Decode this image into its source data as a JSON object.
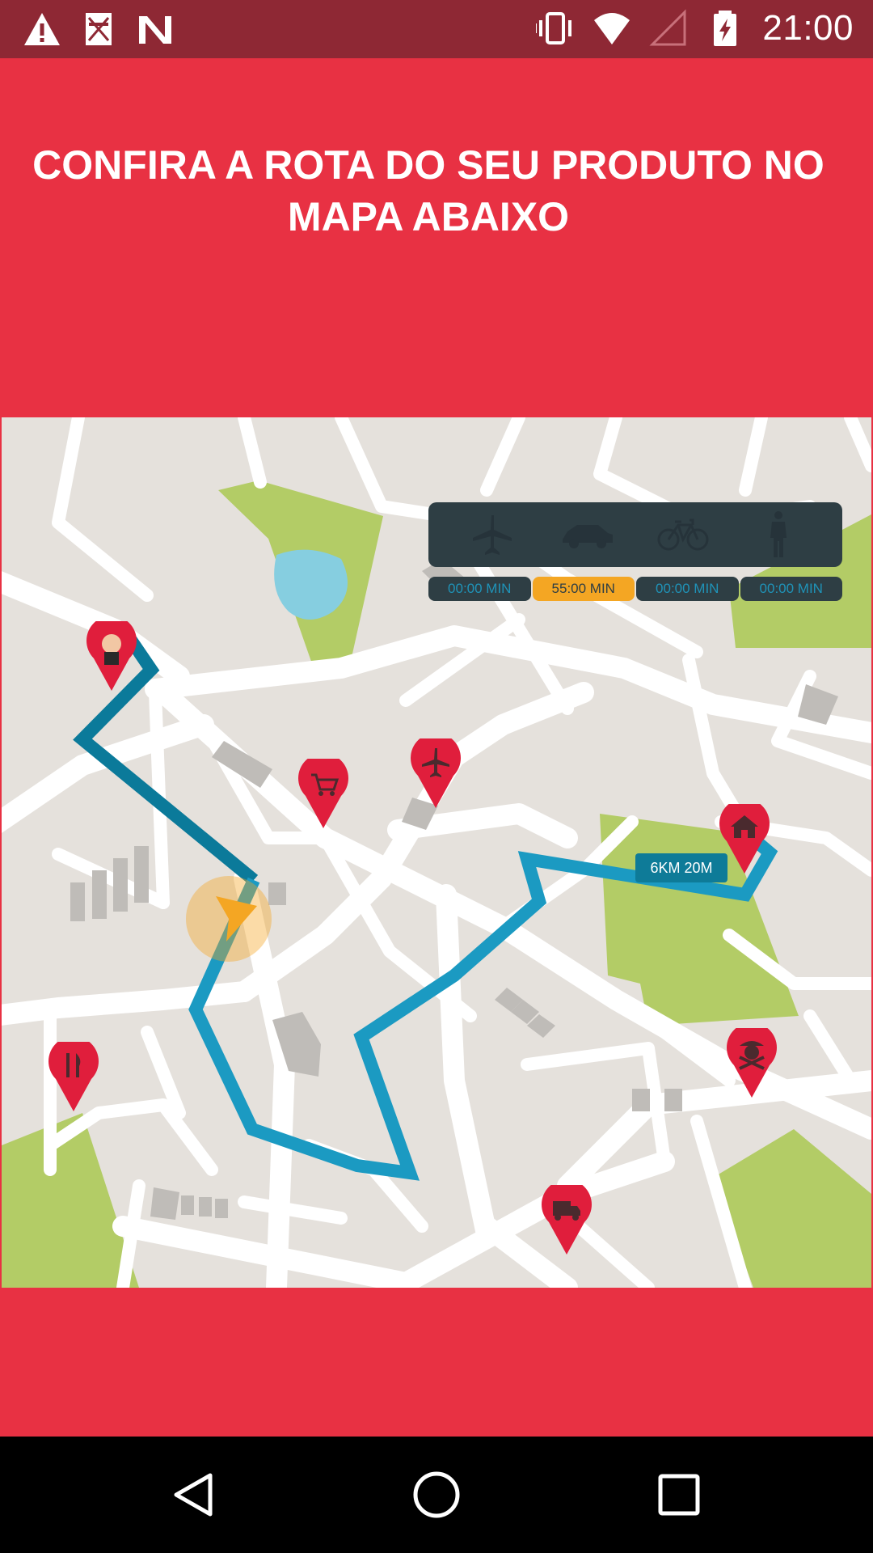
{
  "status_bar": {
    "time": "21:00",
    "left_icons": [
      "warning-icon",
      "no-sim-notification-icon",
      "n-icon"
    ],
    "right_icons": [
      "vibrate-icon",
      "wifi-icon",
      "signal-icon",
      "battery-charging-icon"
    ]
  },
  "header": {
    "title": "CONFIRA A ROTA DO SEU PRODUTO NO MAPA ABAIXO"
  },
  "map": {
    "transport_modes": [
      {
        "mode": "plane-icon",
        "time": "00:00 MIN",
        "active": false
      },
      {
        "mode": "car-icon",
        "time": "55:00 MIN",
        "active": true
      },
      {
        "mode": "bicycle-icon",
        "time": "00:00 MIN",
        "active": false
      },
      {
        "mode": "walking-icon",
        "time": "00:00 MIN",
        "active": false
      }
    ],
    "distance_label": "6KM 20M",
    "pins": [
      "avatar-pin",
      "cart-pin",
      "plane-pin",
      "home-pin",
      "pirate-pin",
      "restaurant-pin",
      "truck-pin"
    ]
  },
  "nav_bar": {
    "buttons": [
      "back-icon",
      "home-circle-icon",
      "recents-icon"
    ]
  },
  "colors": {
    "status_bar": "#8e2834",
    "background": "#e83143",
    "route": "#1b9ac2",
    "route_dark": "#0b7a9a",
    "pin": "#e01e3c",
    "park": "#b3cc66",
    "water": "#86cee0",
    "accent": "#f4a623"
  }
}
